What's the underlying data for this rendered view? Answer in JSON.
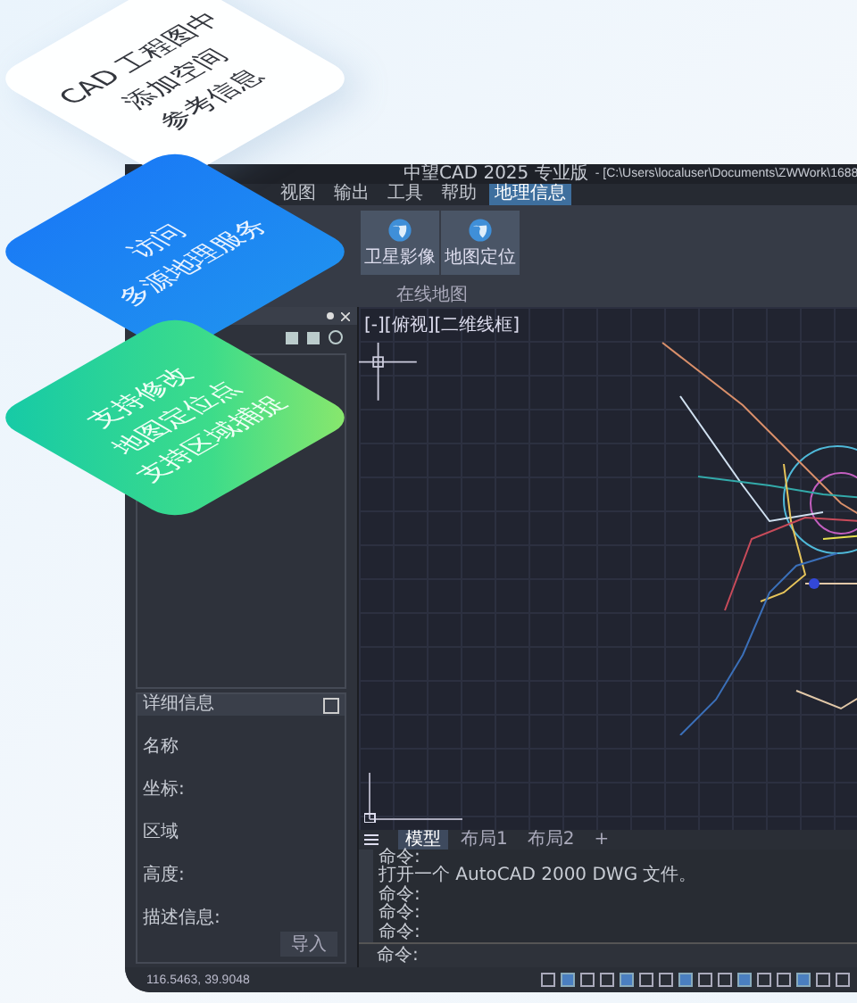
{
  "feature_cards": [
    {
      "kind": "white",
      "lines": [
        "CAD 工程图中",
        "添加空间",
        "参考信息"
      ]
    },
    {
      "kind": "blue",
      "lines": [
        "访问",
        "多源地理服务"
      ]
    },
    {
      "kind": "green",
      "lines": [
        "支持修改",
        "地图定位点",
        "支持区域捕捉"
      ]
    }
  ],
  "window": {
    "title": "中望CAD 2025 专业版",
    "path": "- [C:\\Users\\localuser\\Documents\\ZWWork\\1688"
  },
  "menu_tabs": [
    {
      "label": "视图",
      "selected": false
    },
    {
      "label": "输出",
      "selected": false
    },
    {
      "label": "工具",
      "selected": false
    },
    {
      "label": "帮助",
      "selected": false
    },
    {
      "label": "地理信息",
      "selected": true
    }
  ],
  "ribbon": {
    "buttons": [
      "卫星影像",
      "地图定位"
    ],
    "panel_label": "在线地图"
  },
  "viewport_label": "[-][俯视][二维线框]",
  "properties_panel": {
    "title": "详细信息",
    "fields": [
      "名称",
      "坐标:",
      "区域",
      "高度:",
      "描述信息:"
    ],
    "button": "导入"
  },
  "layout_tabs": [
    {
      "label": "模型",
      "selected": true
    },
    {
      "label": "布局1",
      "selected": false
    },
    {
      "label": "布局2",
      "selected": false
    },
    {
      "label": "+",
      "selected": false
    }
  ],
  "command_history": [
    "命令:",
    "打开一个 AutoCAD 2000 DWG 文件。",
    "命令:",
    "命令:",
    "命令:"
  ],
  "command_prompt": "命令:",
  "status_bar": {
    "coordinates": "116.5463, 39.9048"
  }
}
